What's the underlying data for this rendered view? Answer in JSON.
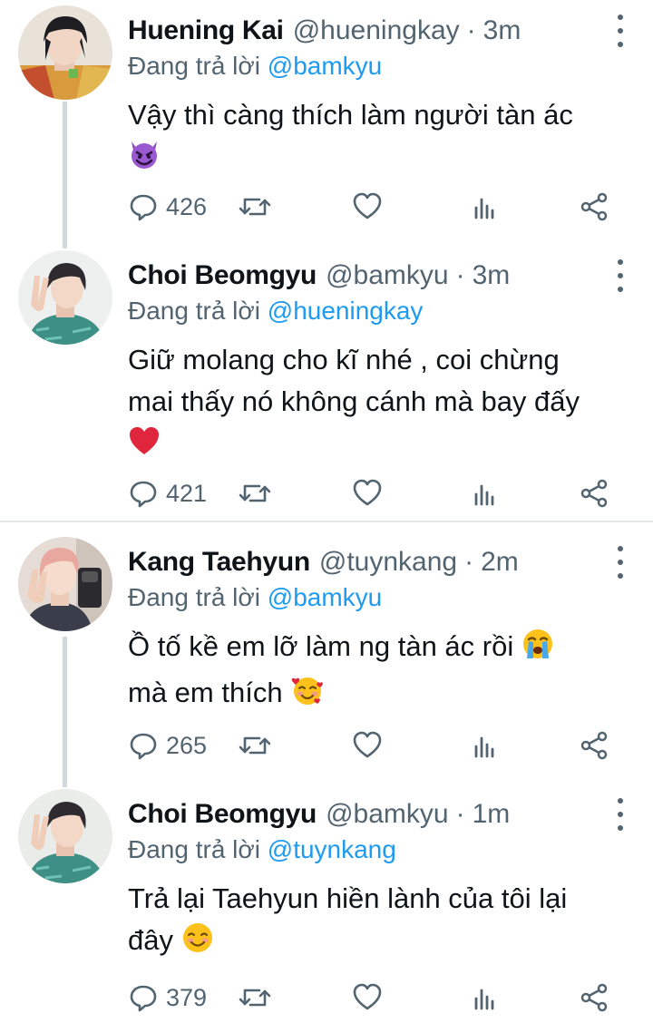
{
  "tweets": [
    {
      "name": "Huening Kai",
      "handle": "@hueningkay",
      "time": "3m",
      "replying_label": "Đang trả lời",
      "replying_to": "@bamkyu",
      "text_lines": [
        "Vậy thì càng thích làm người tàn ác"
      ],
      "emoji": "smiling-imp",
      "replies": "426"
    },
    {
      "name": "Choi Beomgyu",
      "handle": "@bamkyu",
      "time": "3m",
      "replying_label": "Đang trả lời",
      "replying_to": "@hueningkay",
      "text_lines": [
        "Giữ molang cho kĩ nhé , coi chừng",
        "mai thấy nó không cánh mà bay đấy"
      ],
      "emoji": "red-heart",
      "replies": "421"
    },
    {
      "name": "Kang Taehyun",
      "handle": "@tuynkang",
      "time": "2m",
      "replying_label": "Đang trả lời",
      "replying_to": "@bamkyu",
      "text_lines": [
        "Ồ tố kề em lỡ làm ng tàn ác rồi",
        "mà em thích"
      ],
      "emoji": "crying-face, smiling-face-with-hearts",
      "replies": "265"
    },
    {
      "name": "Choi Beomgyu",
      "handle": "@bamkyu",
      "time": "1m",
      "replying_label": "Đang trả lời",
      "replying_to": "@tuynkang",
      "text_lines": [
        "Trả lại Taehyun hiền lành của tôi lại",
        "đây"
      ],
      "emoji": "smiling-face",
      "replies": "379"
    }
  ],
  "colors": {
    "mention": "#1d9bf0",
    "secondary_text": "#536471",
    "thread_line": "#cfd9de",
    "divider": "#e3e7ea"
  }
}
